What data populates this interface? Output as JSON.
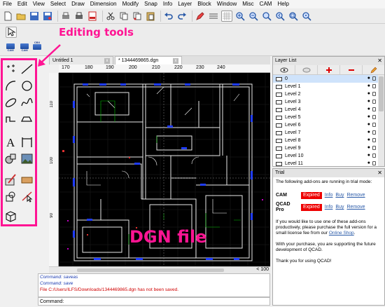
{
  "menu": [
    "File",
    "Edit",
    "View",
    "Select",
    "Draw",
    "Dimension",
    "Modify",
    "Snap",
    "Info",
    "Layer",
    "Block",
    "Window",
    "Misc",
    "CAM",
    "Help"
  ],
  "annotation_editing": "Editing tools",
  "annotation_dgn": "DGN file",
  "tabs": [
    {
      "label": "Untitled 1"
    },
    {
      "label": "* 1344469865.dgn"
    }
  ],
  "ruler_top_ticks": [
    "170",
    "180",
    "190",
    "200",
    "210",
    "220",
    "230",
    "240"
  ],
  "ruler_left_ticks": [
    "110",
    "100",
    "90"
  ],
  "hscroll_value": "< 100",
  "command_history": [
    {
      "text": "Command: saveas",
      "color": "#1a3ab0"
    },
    {
      "text": "Command: save",
      "color": "#1a3ab0"
    },
    {
      "text": "File C:/Users/ILFS/Downloads/1344469865.dgn has not been saved.",
      "color": "#d00000"
    }
  ],
  "command_label": "Command:",
  "layer_panel": {
    "title": "Layer List",
    "layers": [
      "0",
      "Level 1",
      "Level 2",
      "Level 3",
      "Level 4",
      "Level 5",
      "Level 6",
      "Level 7",
      "Level 8",
      "Level 9",
      "Level 10",
      "Level 11"
    ]
  },
  "trial_panel": {
    "title": "Trial",
    "intro": "The following add-ons are running in trial mode:",
    "addons": [
      {
        "name": "CAM",
        "status": "Expired",
        "info": "Info",
        "buy": "Buy",
        "remove": "Remove"
      },
      {
        "name": "QCAD Pro",
        "status": "Expired",
        "info": "Info",
        "buy": "Buy",
        "remove": "Remove"
      }
    ],
    "para1": "If you would like to use one of these add-ons productively, please purchase the full version for a small license fee from our",
    "shop": "Online Shop",
    "para2": "With your purchase, you are supporting the future development of QCAD.",
    "para3": "Thank you for using QCAD!"
  },
  "colors": {
    "annotation": "#ff1493",
    "expired": "#ee0000",
    "link": "#2a5aa8"
  }
}
